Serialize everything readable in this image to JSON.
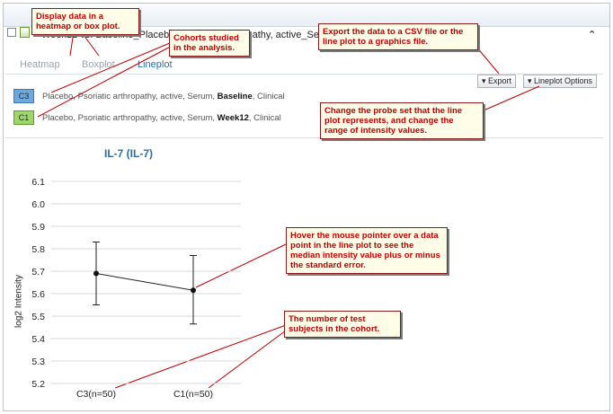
{
  "window": {
    "title": "Week12 vs. Baseline_Placebo, Psoriatic arthropathy, active_Se",
    "collapse_glyph": "⌃"
  },
  "tabs": [
    {
      "label": "Heatmap",
      "active": false
    },
    {
      "label": "Boxplot",
      "active": false
    },
    {
      "label": "Lineplot",
      "active": true
    }
  ],
  "toolbar": {
    "export_label": "▾ Export",
    "lineplot_options_label": "▾ Lineplot Options"
  },
  "cohorts": [
    {
      "badge": "C3",
      "desc": "Placebo, Psoriatic arthropathy, active, Serum, ",
      "timepoint": "Baseline",
      "suffix": ", Clinical",
      "color": "#6fa8dc"
    },
    {
      "badge": "C1",
      "desc": "Placebo, Psoriatic arthropathy, active, Serum, ",
      "timepoint": "Week12",
      "suffix": ", Clinical",
      "color": "#9fd66b"
    }
  ],
  "chart_data": {
    "type": "line",
    "title": "IL-7 (IL-7)",
    "xlabel": "",
    "ylabel": "log2 Intensity",
    "categories": [
      "C3(n=50)",
      "C1(n=50)"
    ],
    "values": [
      5.69,
      5.615
    ],
    "error_upper": [
      5.83,
      5.77
    ],
    "error_lower": [
      5.55,
      5.465
    ],
    "ylim": [
      5.2,
      6.1
    ],
    "yticks": [
      "6.1",
      "6.0",
      "5.9",
      "5.8",
      "5.7",
      "5.6",
      "5.5",
      "5.4",
      "5.3",
      "5.2"
    ],
    "grid": true
  },
  "callouts": {
    "display": "Display data in a heatmap or box plot.",
    "cohorts": "Cohorts studied in the analysis.",
    "export": "Export the data to a CSV file or the line plot to a graphics file.",
    "probe": "Change the probe set that the line plot represents, and change the range of intensity values.",
    "hover": "Hover the mouse pointer over a data point in the line plot to see the median intensity value plus or minus the standard error.",
    "subjects": "The number of test subjects in the cohort."
  }
}
